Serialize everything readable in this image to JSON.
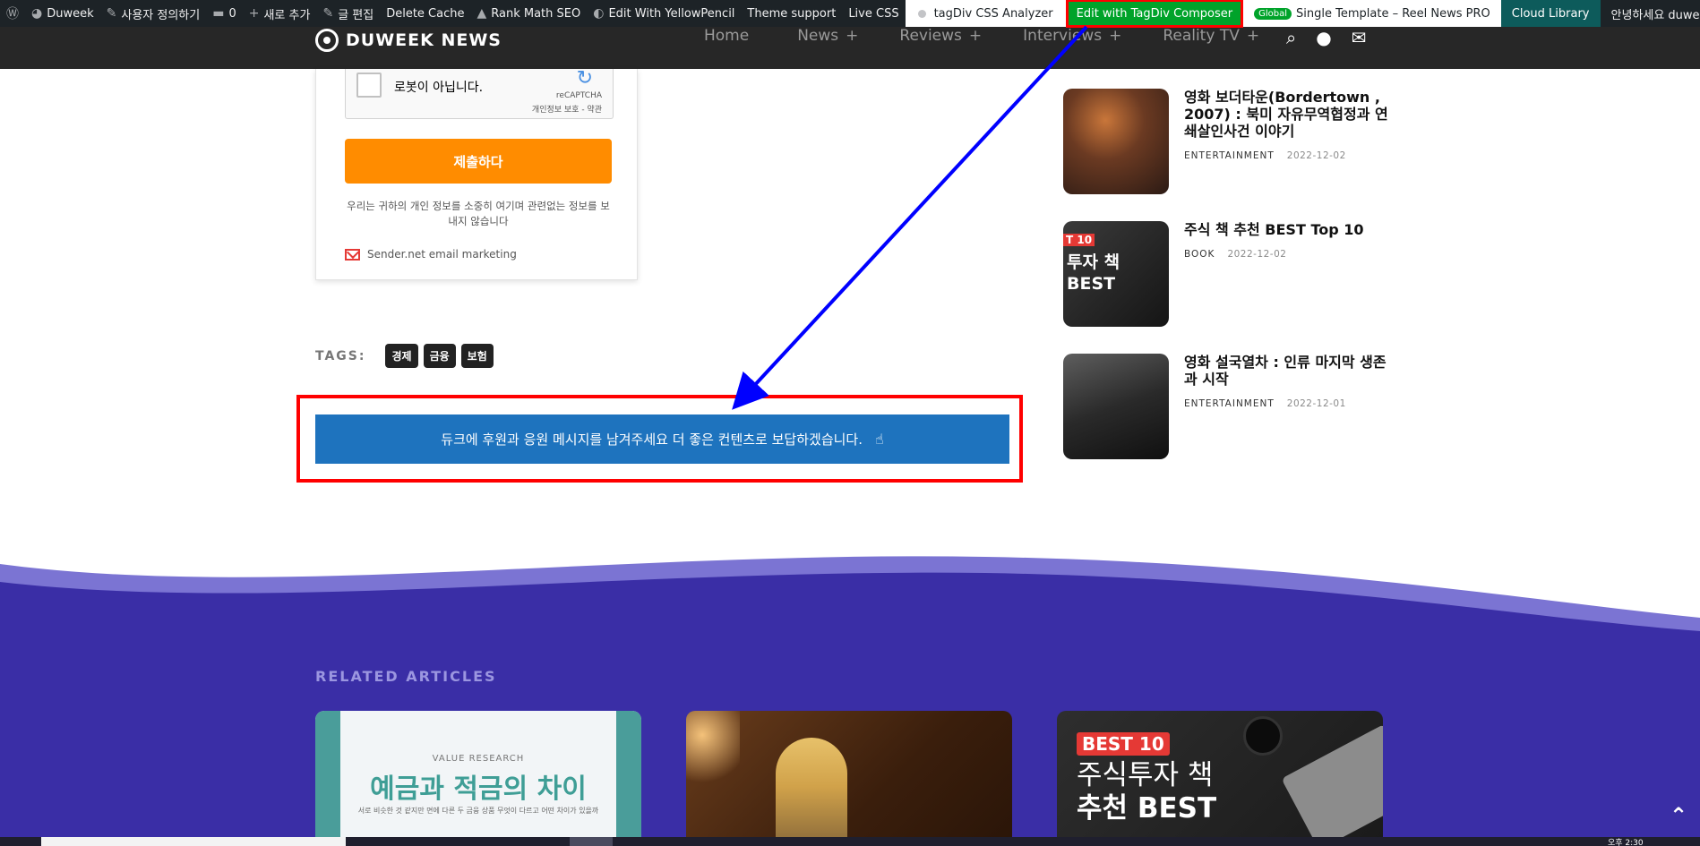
{
  "adminbar": {
    "site_name": "Duweek",
    "customize": "사용자 정의하기",
    "comments_count": "0",
    "new_item": "새로 추가",
    "edit_post": "글 편집",
    "delete_cache": "Delete Cache",
    "rank_math": "Rank Math SEO",
    "yellow_pencil": "Edit With YellowPencil",
    "theme_support": "Theme support",
    "live_css": "Live CSS",
    "css_analyzer": "tagDiv CSS Analyzer",
    "composer": "Edit with TagDiv Composer",
    "global_badge": "Global",
    "template": "Single Template – Reel News PRO",
    "cloud_library": "Cloud Library",
    "greeting": "안녕하세요 duweek님"
  },
  "header": {
    "logo": "DUWEEK NEWS",
    "nav": [
      {
        "label": "Home",
        "plus": ""
      },
      {
        "label": "News",
        "plus": "+"
      },
      {
        "label": "Reviews",
        "plus": "+"
      },
      {
        "label": "Interviews",
        "plus": "+"
      },
      {
        "label": "Reality TV",
        "plus": "+"
      }
    ]
  },
  "form": {
    "recaptcha_label": "로봇이 아닙니다.",
    "recaptcha_brand": "reCAPTCHA",
    "recaptcha_links": "개인정보 보호 - 약관",
    "submit_label": "제출하다",
    "privacy_note": "우리는 귀하의 개인 정보를 소중히 여기며 관련없는 정보를 보내지 않습니다",
    "sender_label": "Sender.net email marketing"
  },
  "tags": {
    "label": "TAGS:",
    "items": [
      "경제",
      "금융",
      "보험"
    ]
  },
  "support_banner": {
    "text": "듀크에 후원과 응원 메시지를 남겨주세요 더 좋은 컨텐츠로 보답하겠습니다."
  },
  "sidebar_posts": [
    {
      "title": "영화 보더타운(Bordertown , 2007) : 북미 자유무역협정과 연쇄살인사건 이야기",
      "category": "ENTERTAINMENT",
      "date": "2022-12-02"
    },
    {
      "title": "주식 책 추천 BEST Top 10",
      "category": "BOOK",
      "date": "2022-12-02",
      "thumb_badge": "T 10",
      "thumb_text": "투자 책 BEST"
    },
    {
      "title": "영화 설국열차 : 인류 마지막 생존과 시작",
      "category": "ENTERTAINMENT",
      "date": "2022-12-01"
    }
  ],
  "related": {
    "label": "RELATED ARTICLES",
    "card1": {
      "kicker": "VALUE RESEARCH",
      "title": "예금과 적금의 차이",
      "sub": "서로 비슷한 것 같지만 면에 다른 두 금융 상품 무엇이 다르고 어떤 차이가 있을까"
    },
    "card3": {
      "badge": "BEST 10",
      "title_line1": "주식투자 책",
      "title_line2": "추천 BEST"
    }
  },
  "taskbar": {
    "clock": "오후 2:30"
  },
  "colors": {
    "adminbar": "#1d2327",
    "composer_green": "#00a32a",
    "highlight_red": "#ff0000",
    "arrow_blue": "#0000ff",
    "submit_orange": "#ff8c00",
    "banner_blue": "#1e73be",
    "footer_purple": "#3a2ea6"
  },
  "icons": {
    "wp_logo": "wordpress-icon",
    "scroll_top": "chevron-up-icon"
  }
}
